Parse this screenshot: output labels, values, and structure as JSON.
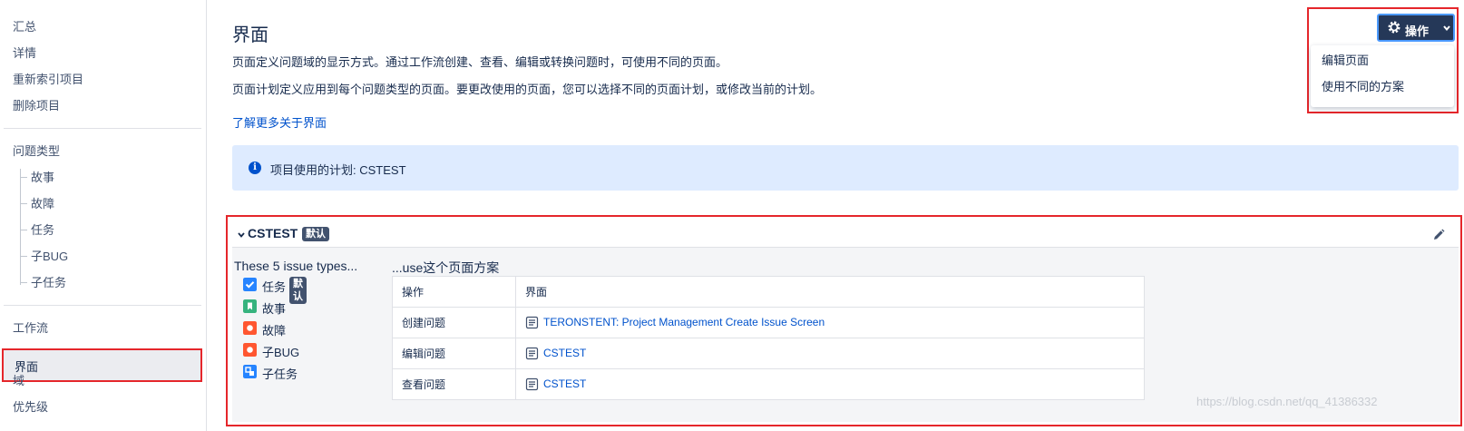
{
  "sidebar": {
    "items_top": [
      "汇总",
      "详情",
      "重新索引项目",
      "删除项目"
    ],
    "issue_types_label": "问题类型",
    "issue_types": [
      "故事",
      "故障",
      "任务",
      "子BUG",
      "子任务"
    ],
    "workflow": "工作流",
    "screens": "界面",
    "fields": "域",
    "priority": "优先级"
  },
  "header": {
    "title": "界面",
    "desc1": "页面定义问题域的显示方式。通过工作流创建、查看、编辑或转换问题时，可使用不同的页面。",
    "desc2": "页面计划定义应用到每个问题类型的页面。要更改使用的页面，您可以选择不同的页面计划，或修改当前的计划。",
    "learn_more": "了解更多关于界面"
  },
  "info_banner": {
    "text": "项目使用的计划: CSTEST"
  },
  "actions": {
    "button_label": "操作",
    "menu": [
      "编辑页面",
      "使用不同的方案"
    ]
  },
  "scheme": {
    "name": "CSTEST",
    "default_badge": "默认",
    "issue_types_heading": "These 5 issue types...",
    "use_heading": "...use这个页面方案",
    "issue_types": [
      {
        "label": "任务",
        "icon": "task-icon",
        "color": "#2684ff",
        "default": "默认"
      },
      {
        "label": "故事",
        "icon": "story-icon",
        "color": "#36b37e"
      },
      {
        "label": "故障",
        "icon": "bug-icon",
        "color": "#ff5630"
      },
      {
        "label": "子BUG",
        "icon": "bug-icon",
        "color": "#ff5630"
      },
      {
        "label": "子任务",
        "icon": "subtask-icon",
        "color": "#2684ff"
      }
    ],
    "table": {
      "headers": [
        "操作",
        "界面"
      ],
      "rows": [
        {
          "operation": "创建问题",
          "screen": "TERONSTENT: Project Management Create Issue Screen"
        },
        {
          "operation": "编辑问题",
          "screen": "CSTEST"
        },
        {
          "operation": "查看问题",
          "screen": "CSTEST"
        }
      ]
    }
  },
  "watermark": "https://blog.csdn.net/qq_41386332",
  "colors": {
    "accent": "#0052cc",
    "highlight": "#e5262b",
    "banner": "#deebff",
    "button": "#253858"
  }
}
